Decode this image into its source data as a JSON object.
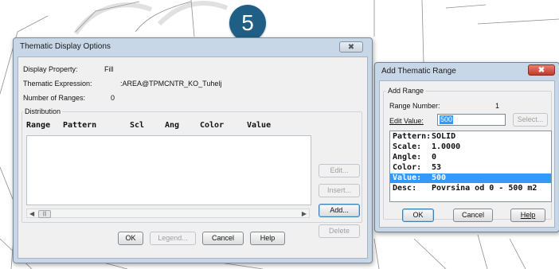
{
  "step_badge": "5",
  "thematic_dialog": {
    "title": "Thematic Display Options",
    "display_property_label": "Display Property:",
    "display_property_value": "Fill",
    "expression_label": "Thematic Expression:",
    "expression_value": ":AREA@TPMCNTR_KO_Tuhelj",
    "ranges_label": "Number of Ranges:",
    "ranges_value": "0",
    "distribution_label": "Distribution",
    "columns": [
      "Range",
      "Pattern",
      "Scl",
      "Ang",
      "Color",
      "Value"
    ],
    "side_buttons": {
      "edit": "Edit...",
      "insert": "Insert...",
      "add": "Add...",
      "delete": "Delete"
    },
    "buttons": {
      "ok": "OK",
      "legend": "Legend...",
      "cancel": "Cancel",
      "help": "Help"
    }
  },
  "add_range_dialog": {
    "title": "Add Thematic Range",
    "group_label": "Add Range",
    "range_number_label": "Range Number:",
    "range_number_value": "1",
    "edit_value_label": "Edit Value:",
    "edit_value_value": "500",
    "select_button": "Select...",
    "list": [
      {
        "key": "Pattern:",
        "value": "SOLID"
      },
      {
        "key": "Scale:",
        "value": "1.0000"
      },
      {
        "key": "Angle:",
        "value": "0"
      },
      {
        "key": "Color:",
        "value": "53"
      },
      {
        "key": "Value:",
        "value": "500"
      },
      {
        "key": "Desc:",
        "value": "Povrsina od 0 - 500 m2"
      }
    ],
    "buttons": {
      "ok": "OK",
      "cancel": "Cancel",
      "help": "Help"
    }
  }
}
